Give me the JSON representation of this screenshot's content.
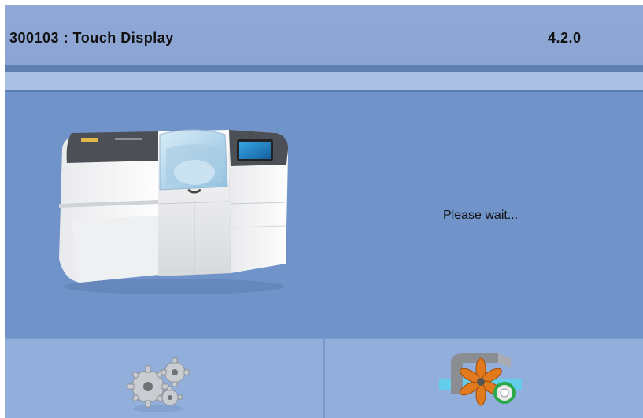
{
  "header": {
    "title": "300103 : Touch Display",
    "version": "4.2.0"
  },
  "main": {
    "status_message": "Please wait...",
    "image": "milling-machine-image"
  },
  "footer": {
    "left_button_icon": "gears-icon",
    "right_button_icon": "fan-motor-icon"
  },
  "colors": {
    "header_bg": "#8ea7d5",
    "main_bg": "#7093c9",
    "footer_bg": "#92aedb",
    "strip_bg": "#a9bfe3"
  }
}
